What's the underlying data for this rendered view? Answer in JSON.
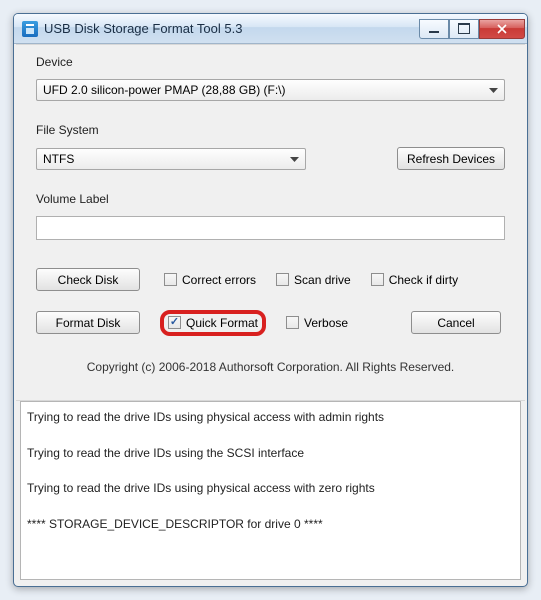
{
  "window": {
    "title": "USB Disk Storage Format Tool 5.3"
  },
  "labels": {
    "device": "Device",
    "file_system": "File System",
    "volume_label": "Volume Label"
  },
  "device": {
    "selected": "UFD 2.0  silicon-power  PMAP (28,88 GB) (F:\\)"
  },
  "file_system": {
    "selected": "NTFS"
  },
  "volume_label": {
    "value": ""
  },
  "buttons": {
    "refresh": "Refresh Devices",
    "check_disk": "Check Disk",
    "format_disk": "Format Disk",
    "cancel": "Cancel"
  },
  "checkboxes": {
    "correct_errors": "Correct errors",
    "scan_drive": "Scan drive",
    "check_if_dirty": "Check if dirty",
    "quick_format": "Quick Format",
    "verbose": "Verbose"
  },
  "copyright": "Copyright (c) 2006-2018 Authorsoft Corporation. All Rights Reserved.",
  "log": [
    "Trying to read the drive IDs using physical access with admin rights",
    "Trying to read the drive IDs using the SCSI interface",
    "Trying to read the drive IDs using physical access with zero rights",
    "**** STORAGE_DEVICE_DESCRIPTOR for drive 0 ****"
  ]
}
